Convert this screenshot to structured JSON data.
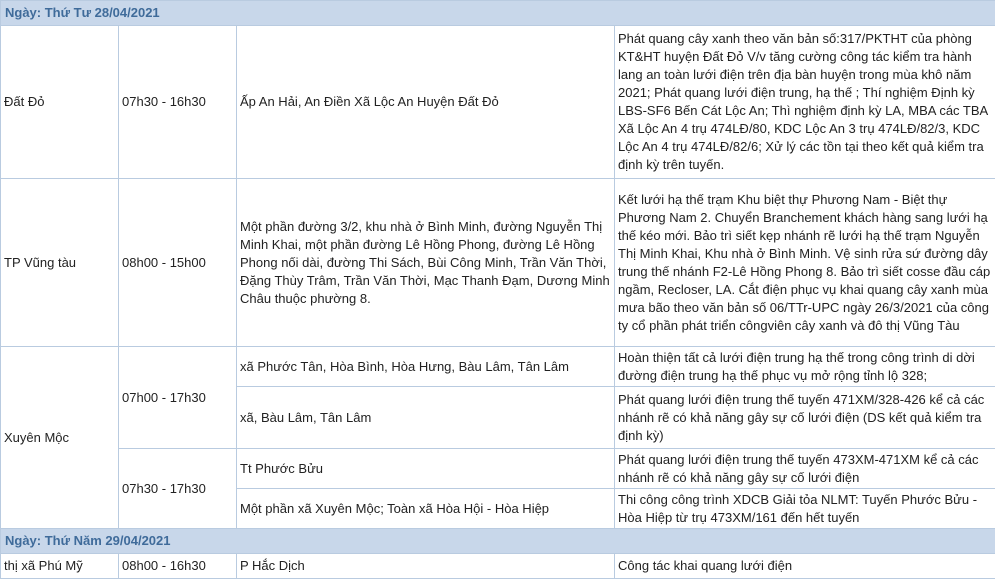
{
  "days": [
    {
      "date_label": "Ngày: Thứ Tư 28/04/2021",
      "d1": {
        "area": "Đất Đỏ",
        "time": "07h30 - 16h30",
        "location": "Ấp An Hải, An Điền Xã Lộc An Huyện Đất Đỏ",
        "work": "Phát quang cây xanh theo văn bản số:317/PKTHT của phòng KT&HT huyện Đất Đỏ V/v tăng cường công tác kiểm tra hành lang an toàn lưới điện trên địa bàn huyện trong mùa khô năm 2021; Phát quang lưới điện trung, hạ thế ; Thí nghiệm Định kỳ LBS-SF6 Bến Cát Lộc An; Thì nghiệm định kỳ LA, MBA các TBA Xã Lộc An 4 trụ 474LĐ/80, KDC Lộc An 3 trụ 474LĐ/82/3, KDC Lộc An 4 trụ 474LĐ/82/6; Xử lý các tồn tại theo kết quả kiểm tra định kỳ trên tuyến."
      },
      "d2": {
        "area": "TP Vũng tàu",
        "time": "08h00 - 15h00",
        "location": "Một phần đường 3/2, khu nhà ở Bình Minh, đường Nguyễn Thị Minh Khai, một phần đường Lê Hồng Phong, đường Lê Hồng Phong nối dài, đường Thi Sách, Bùi Công Minh, Trần Văn Thời, Đặng Thùy Trâm, Trần Văn Thời, Mạc Thanh Đạm, Dương Minh Châu thuộc phường 8.",
        "work": "Kết lưới hạ thế trạm Khu biệt thự Phương Nam - Biệt thự Phương Nam 2. Chuyển Branchement khách hàng sang lưới hạ thế kéo mới. Bảo trì siết kẹp nhánh rẽ lưới hạ thế trạm Nguyễn Thị Minh Khai, Khu nhà ở Bình Minh. Vệ sinh rửa sứ đường dây trung thế nhánh F2-Lê Hồng Phong 8. Bảo trì siết cosse đầu cáp ngầm, Recloser, LA. Cắt điện phục vụ khai quang cây xanh mùa mưa bão theo văn bản số 06/TTr-UPC ngày 26/3/2021 của công ty cổ phần phát triển côngviên cây xanh và đô thị Vũng Tàu"
      },
      "d3": {
        "area": "Xuyên Mộc",
        "time_a": "07h00 - 17h30",
        "time_b": "07h30 - 17h30",
        "loc1": "xã Phước Tân, Hòa Bình, Hòa Hưng, Bàu Lâm, Tân Lâm",
        "work1": "Hoàn thiện tất cả lưới điện trung hạ thế trong công trình di dời đường điện trung hạ thế phục vụ mở rộng tỉnh lộ 328;",
        "loc2": "xã, Bàu Lâm, Tân Lâm",
        "work2": "Phát quang lưới điện trung thế tuyến 471XM/328-426 kể cả các nhánh rẽ có khả năng gây sự cố lưới điện (DS kết quả kiểm tra định kỳ)",
        "loc3": "Tt Phước Bửu",
        "work3": "Phát quang lưới điện trung thế tuyến 473XM-471XM kể cả các nhánh rẽ có khả năng gây sự cố lưới điện",
        "loc4": "Một phần xã Xuyên Mộc; Toàn xã Hòa Hội - Hòa Hiệp",
        "work4": "Thi công công trình XDCB Giải tỏa NLMT: Tuyến Phước Bửu - Hòa Hiệp từ trụ 473XM/161 đến hết tuyến"
      }
    },
    {
      "date_label": "Ngày: Thứ Năm 29/04/2021",
      "d1": {
        "area": "thị xã Phú Mỹ",
        "time": "08h00 - 16h30",
        "location": "P Hắc Dịch",
        "work": "Công tác khai quang lưới điện"
      }
    }
  ]
}
